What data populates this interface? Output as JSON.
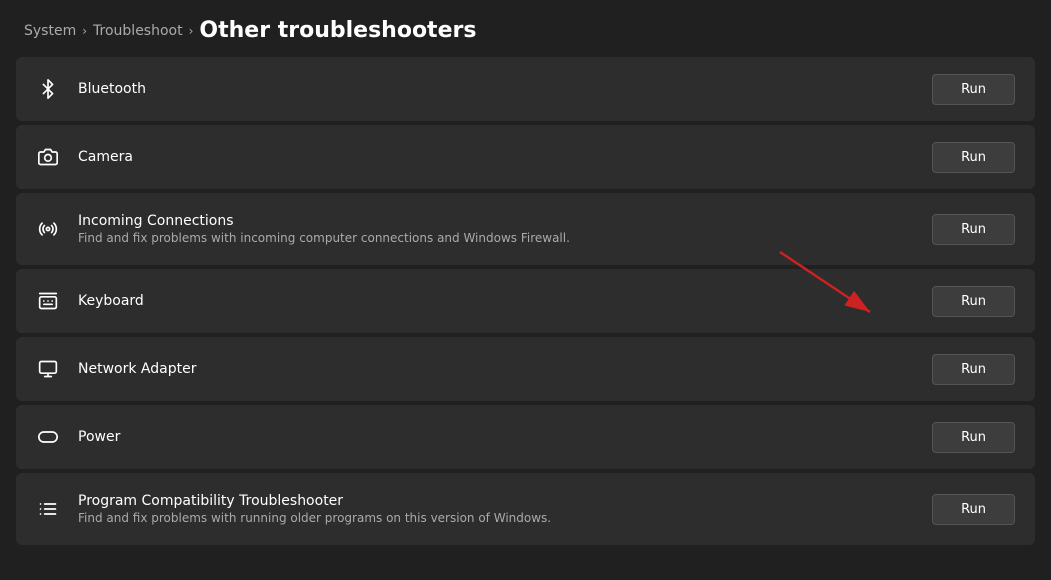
{
  "header": {
    "breadcrumb1": "System",
    "breadcrumb2": "Troubleshoot",
    "breadcrumb3": "Other troubleshooters",
    "separator": "›"
  },
  "troubleshooters": [
    {
      "id": "bluetooth",
      "icon": "bluetooth",
      "title": "Bluetooth",
      "desc": "",
      "button": "Run"
    },
    {
      "id": "camera",
      "icon": "camera",
      "title": "Camera",
      "desc": "",
      "button": "Run"
    },
    {
      "id": "incoming-connections",
      "icon": "wifi",
      "title": "Incoming Connections",
      "desc": "Find and fix problems with incoming computer connections and Windows Firewall.",
      "button": "Run"
    },
    {
      "id": "keyboard",
      "icon": "keyboard",
      "title": "Keyboard",
      "desc": "",
      "button": "Run"
    },
    {
      "id": "network-adapter",
      "icon": "monitor",
      "title": "Network Adapter",
      "desc": "",
      "button": "Run"
    },
    {
      "id": "power",
      "icon": "power",
      "title": "Power",
      "desc": "",
      "button": "Run"
    },
    {
      "id": "program-compatibility",
      "icon": "list",
      "title": "Program Compatibility Troubleshooter",
      "desc": "Find and fix problems with running older programs on this version of Windows.",
      "button": "Run"
    }
  ]
}
